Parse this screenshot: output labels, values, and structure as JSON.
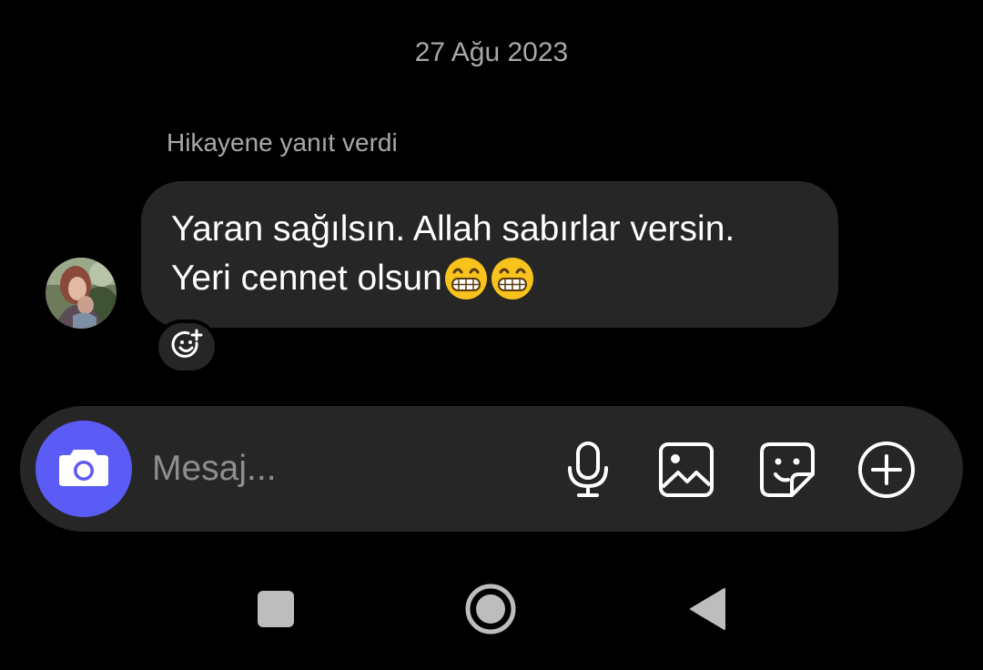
{
  "chat": {
    "date_separator": "27 Ağu 2023",
    "reply_context": "Hikayene yanıt verdi",
    "message": {
      "line1": "Yaran sağılsın. Allah sabırlar versin.",
      "line2": "Yeri cennet olsun",
      "emojis": [
        "grinning-face-emoji",
        "grinning-face-emoji"
      ]
    }
  },
  "composer": {
    "placeholder": "Mesaj...",
    "icons": [
      "camera-icon",
      "microphone-icon",
      "gallery-icon",
      "sticker-icon",
      "plus-icon"
    ]
  },
  "navbar": {
    "icons": [
      "recents-icon",
      "home-icon",
      "back-icon"
    ]
  },
  "colors": {
    "background": "#000000",
    "bubble": "#262626",
    "accent": "#5b5bf5",
    "muted_text": "#a8a8a8"
  }
}
